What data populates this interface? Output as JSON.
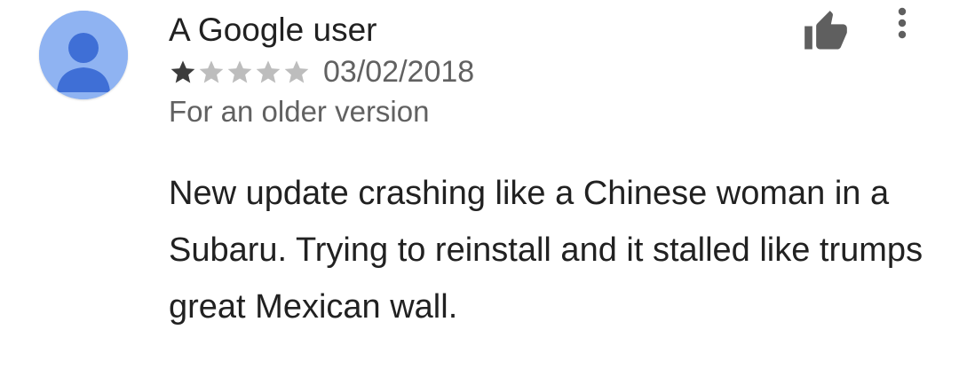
{
  "review": {
    "author": "A Google user",
    "rating": 1,
    "rating_max": 5,
    "date": "03/02/2018",
    "version_note": "For an older version",
    "text": "New update crashing like a Chinese woman in a Subaru. Trying to reinstall and it stalled like trumps great Mexican wall."
  },
  "icons": {
    "avatar": "person-avatar-icon",
    "helpful": "thumbs-up-icon",
    "menu": "more-vert-icon",
    "star_filled": "star-filled-icon",
    "star_empty": "star-empty-icon"
  },
  "colors": {
    "avatar_bg": "#8fb3f2",
    "avatar_fg": "#3f6fd6",
    "star_filled": "#3c3c3c",
    "star_empty": "#bdbdbd",
    "icon": "#5f5f5f"
  }
}
